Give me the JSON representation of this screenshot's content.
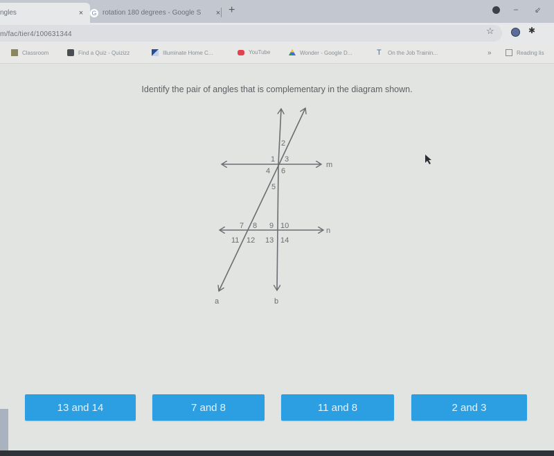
{
  "browser": {
    "tabs": [
      {
        "title": "ngles",
        "active": true,
        "close_label": "×"
      },
      {
        "title": "rotation 180 degrees - Google S",
        "active": false,
        "favicon": "G",
        "close_label": "×"
      }
    ],
    "new_tab_label": "+",
    "window_controls": {
      "minimize": "–",
      "restore": "⇙"
    },
    "url": "m/fac/tier4/100631344",
    "bookmarks": [
      {
        "label": "Classroom",
        "icon": "classroom-icon"
      },
      {
        "label": "Find a Quiz - Quizizz",
        "icon": "quizizz-icon"
      },
      {
        "label": "Illuminate Home C...",
        "icon": "illuminate-icon"
      },
      {
        "label": "YouTube",
        "icon": "youtube-icon"
      },
      {
        "label": "Wonder - Google D...",
        "icon": "google-drive-icon"
      },
      {
        "label": "On the Job Trainin...",
        "icon": "training-icon"
      },
      {
        "label": "Reading lis",
        "icon": "reading-list-icon"
      }
    ],
    "bookmarks_overflow": "»"
  },
  "question": {
    "prompt": "Identify the pair of angles that is complementary in the diagram shown."
  },
  "diagram": {
    "lines": {
      "m": "m",
      "n": "n",
      "a": "a",
      "b": "b"
    },
    "angles_top": [
      "1",
      "2",
      "3",
      "4",
      "5",
      "6"
    ],
    "angles_bottom": [
      "7",
      "8",
      "9",
      "10",
      "11",
      "12",
      "13",
      "14"
    ]
  },
  "choices": [
    {
      "label": "13 and 14"
    },
    {
      "label": "7 and 8"
    },
    {
      "label": "11 and 8"
    },
    {
      "label": "2 and 3"
    }
  ],
  "colors": {
    "choice_button": "#2c9fe2",
    "page_background": "#e2e4e1",
    "diagram_stroke": "#6a6d72"
  }
}
